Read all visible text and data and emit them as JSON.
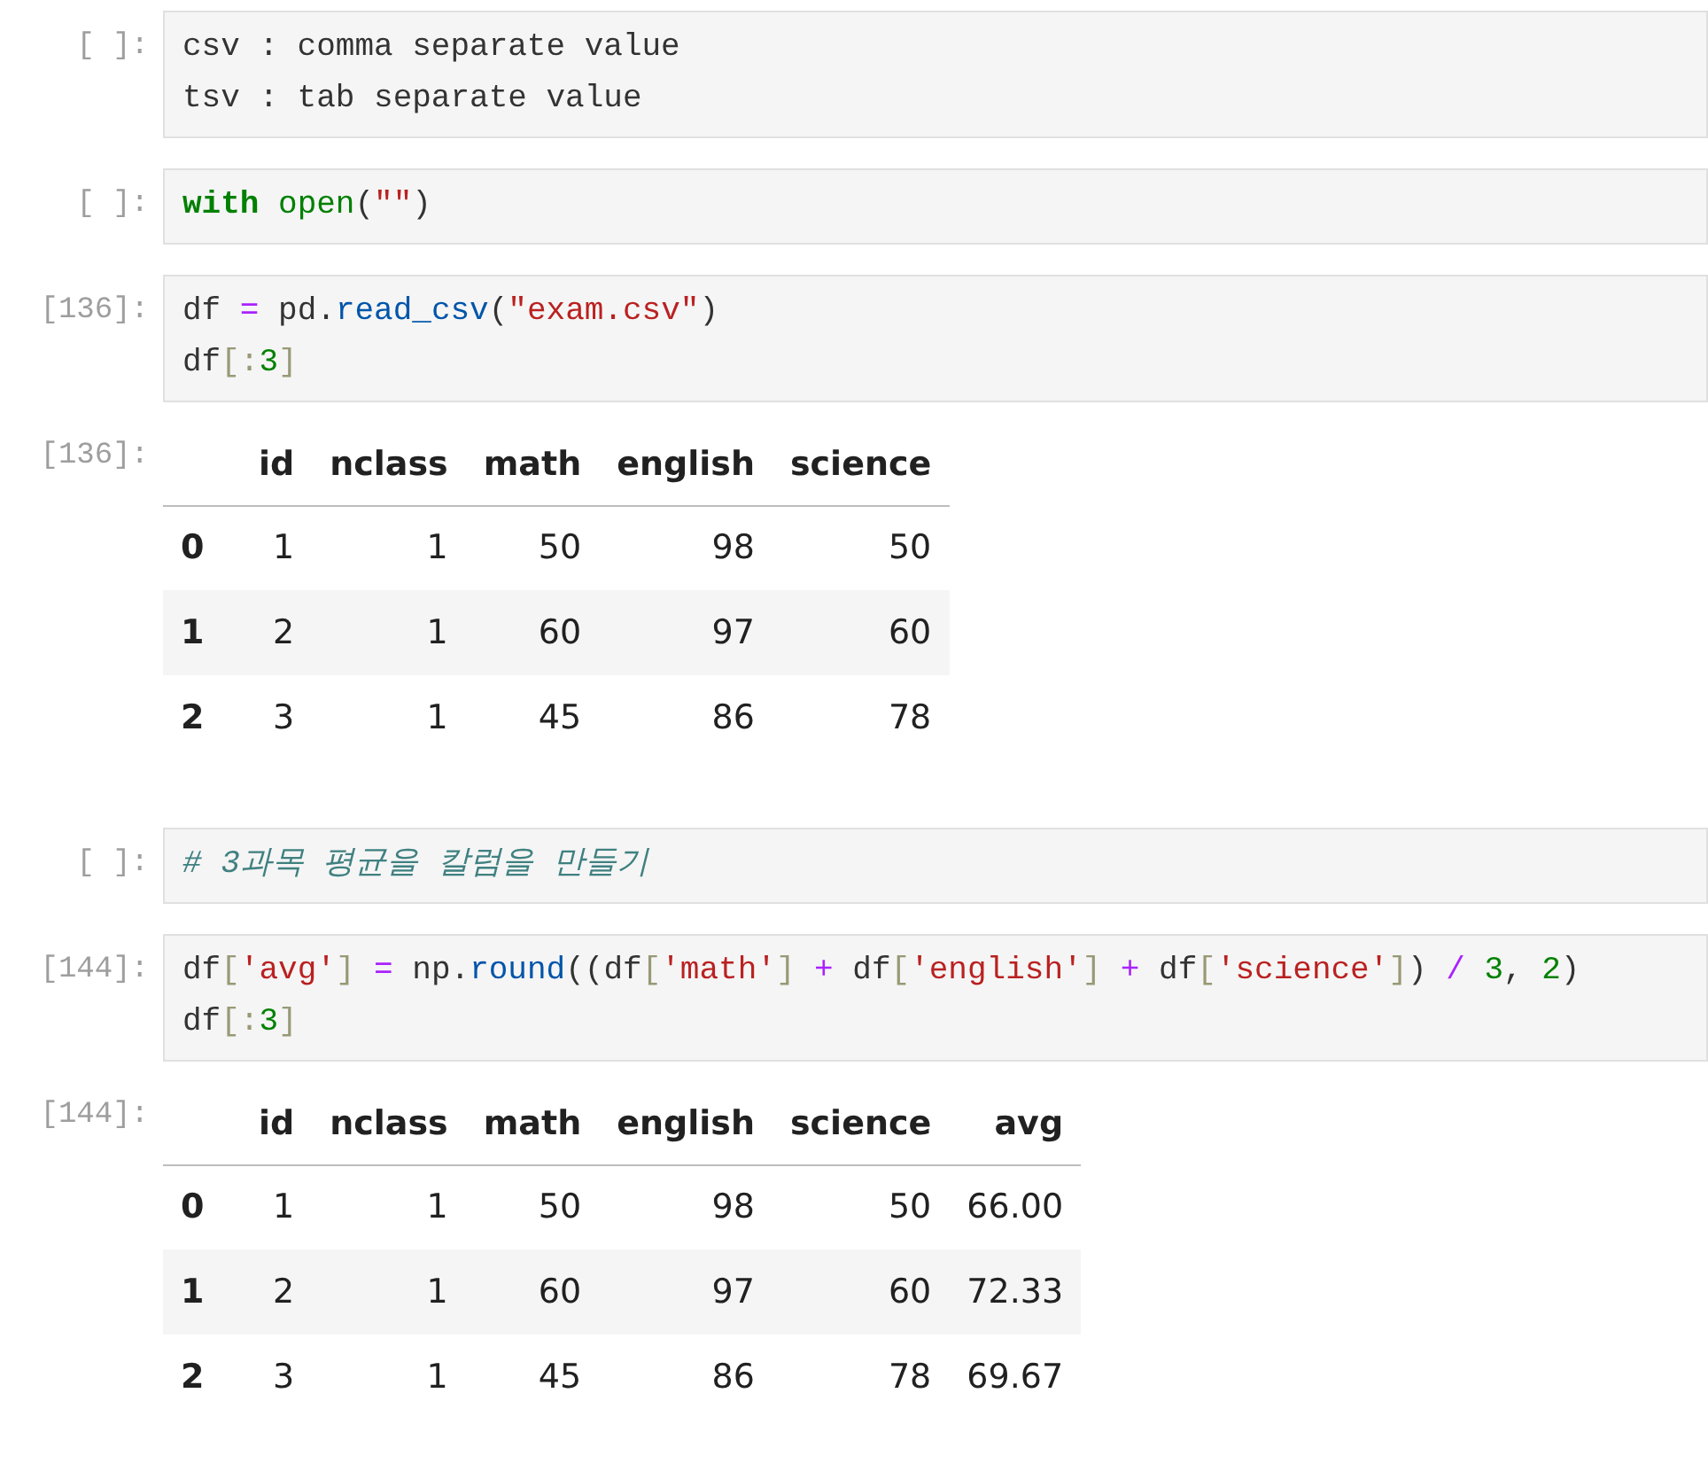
{
  "cells": [
    {
      "kind": "code",
      "prompt": "[ ]:",
      "lines": [
        [
          {
            "kind": "plain",
            "text": "csv : comma separate value"
          }
        ],
        [
          {
            "kind": "plain",
            "text": "tsv : tab separate value"
          }
        ]
      ]
    },
    {
      "kind": "code",
      "prompt": "[ ]:",
      "lines": [
        [
          {
            "kind": "keyword",
            "text": "with"
          },
          {
            "kind": "builtin",
            "text": " open"
          },
          {
            "kind": "plain",
            "text": "("
          },
          {
            "kind": "string",
            "text": "\"\""
          },
          {
            "kind": "plain",
            "text": ")"
          }
        ]
      ]
    },
    {
      "kind": "code",
      "prompt": "[136]:",
      "lines": [
        [
          {
            "kind": "plain",
            "text": "df "
          },
          {
            "kind": "operator",
            "text": "="
          },
          {
            "kind": "plain",
            "text": " pd."
          },
          {
            "kind": "func",
            "text": "read_csv"
          },
          {
            "kind": "plain",
            "text": "("
          },
          {
            "kind": "string",
            "text": "\"exam.csv\""
          },
          {
            "kind": "plain",
            "text": ")"
          }
        ],
        [
          {
            "kind": "plain",
            "text": "df"
          },
          {
            "kind": "bracket",
            "text": "[:"
          },
          {
            "kind": "number",
            "text": "3"
          },
          {
            "kind": "bracket",
            "text": "]"
          }
        ]
      ]
    },
    {
      "kind": "table",
      "prompt": "[136]:",
      "columns": [
        "id",
        "nclass",
        "math",
        "english",
        "science"
      ],
      "rows": [
        {
          "index": "0",
          "cells": [
            "1",
            "1",
            "50",
            "98",
            "50"
          ]
        },
        {
          "index": "1",
          "cells": [
            "2",
            "1",
            "60",
            "97",
            "60"
          ]
        },
        {
          "index": "2",
          "cells": [
            "3",
            "1",
            "45",
            "86",
            "78"
          ]
        }
      ]
    },
    {
      "kind": "code",
      "prompt": "[ ]:",
      "lines": [
        [
          {
            "kind": "comment",
            "text": "# 3과목 평균을 칼럼을 만들기"
          }
        ]
      ]
    },
    {
      "kind": "code",
      "prompt": "[144]:",
      "lines": [
        [
          {
            "kind": "plain",
            "text": "df"
          },
          {
            "kind": "bracket",
            "text": "["
          },
          {
            "kind": "string",
            "text": "'avg'"
          },
          {
            "kind": "bracket",
            "text": "] "
          },
          {
            "kind": "operator",
            "text": "="
          },
          {
            "kind": "plain",
            "text": " np."
          },
          {
            "kind": "func",
            "text": "round"
          },
          {
            "kind": "plain",
            "text": "((df"
          },
          {
            "kind": "bracket",
            "text": "["
          },
          {
            "kind": "string",
            "text": "'math'"
          },
          {
            "kind": "bracket",
            "text": "] "
          },
          {
            "kind": "operator",
            "text": "+"
          },
          {
            "kind": "plain",
            "text": " df"
          },
          {
            "kind": "bracket",
            "text": "["
          },
          {
            "kind": "string",
            "text": "'english'"
          },
          {
            "kind": "bracket",
            "text": "] "
          },
          {
            "kind": "operator",
            "text": "+"
          },
          {
            "kind": "plain",
            "text": " df"
          },
          {
            "kind": "bracket",
            "text": "["
          },
          {
            "kind": "string",
            "text": "'science'"
          },
          {
            "kind": "bracket",
            "text": "]"
          },
          {
            "kind": "plain",
            "text": ") "
          },
          {
            "kind": "operator",
            "text": "/ "
          },
          {
            "kind": "number",
            "text": "3"
          },
          {
            "kind": "plain",
            "text": ", "
          },
          {
            "kind": "number",
            "text": "2"
          },
          {
            "kind": "plain",
            "text": ")"
          }
        ],
        [
          {
            "kind": "plain",
            "text": "df"
          },
          {
            "kind": "bracket",
            "text": "[:"
          },
          {
            "kind": "number",
            "text": "3"
          },
          {
            "kind": "bracket",
            "text": "]"
          }
        ]
      ]
    },
    {
      "kind": "table",
      "prompt": "[144]:",
      "columns": [
        "id",
        "nclass",
        "math",
        "english",
        "science",
        "avg"
      ],
      "rows": [
        {
          "index": "0",
          "cells": [
            "1",
            "1",
            "50",
            "98",
            "50",
            "66.00"
          ]
        },
        {
          "index": "1",
          "cells": [
            "2",
            "1",
            "60",
            "97",
            "60",
            "72.33"
          ]
        },
        {
          "index": "2",
          "cells": [
            "3",
            "1",
            "45",
            "86",
            "78",
            "69.67"
          ]
        }
      ]
    }
  ]
}
